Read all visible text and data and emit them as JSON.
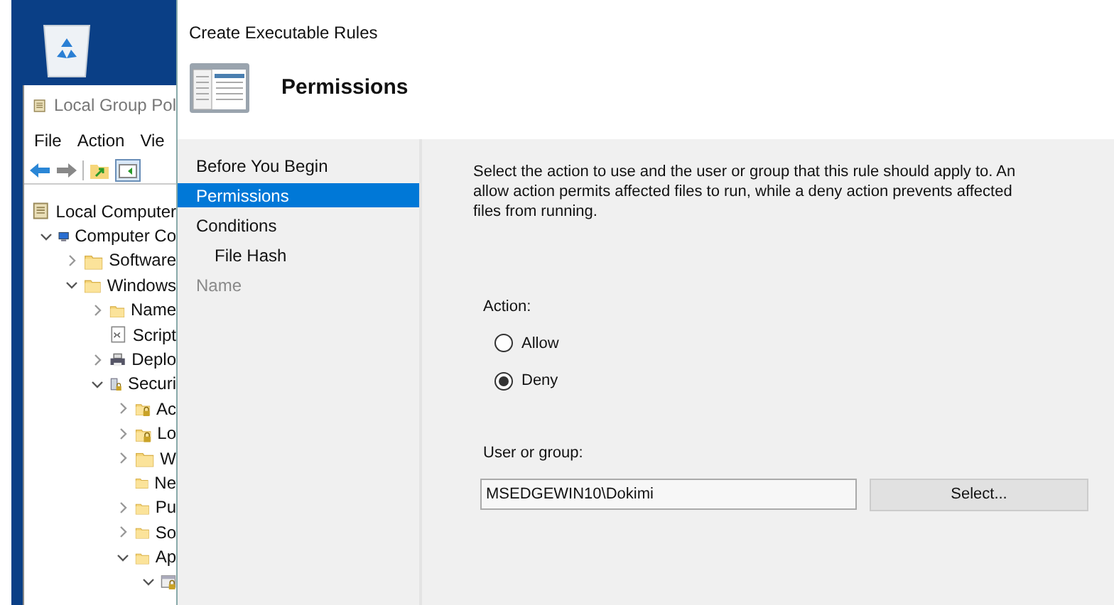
{
  "background_window": {
    "title": "Local Group Pol",
    "menu": [
      "File",
      "Action",
      "Vie"
    ],
    "tree": [
      {
        "label": "Local Computer",
        "kind": "policy",
        "children": [
          {
            "label": "Computer Co",
            "kind": "computer",
            "expanded": true,
            "children": [
              {
                "label": "Software",
                "kind": "folder",
                "expanded": false
              },
              {
                "label": "Windows",
                "kind": "folder",
                "expanded": true,
                "children": [
                  {
                    "label": "Name",
                    "kind": "folder",
                    "expanded": false
                  },
                  {
                    "label": "Script",
                    "kind": "script"
                  },
                  {
                    "label": "Deplo",
                    "kind": "printer",
                    "expanded": false
                  },
                  {
                    "label": "Securi",
                    "kind": "security",
                    "expanded": true,
                    "children": [
                      {
                        "label": "Ac",
                        "kind": "folder-lock",
                        "expanded": false
                      },
                      {
                        "label": "Lo",
                        "kind": "folder-lock",
                        "expanded": false
                      },
                      {
                        "label": "W",
                        "kind": "folder",
                        "expanded": false
                      },
                      {
                        "label": "Ne",
                        "kind": "folder"
                      },
                      {
                        "label": "Pu",
                        "kind": "folder",
                        "expanded": false
                      },
                      {
                        "label": "So",
                        "kind": "folder",
                        "expanded": false
                      },
                      {
                        "label": "Ap",
                        "kind": "folder",
                        "expanded": true,
                        "children": [
                          {
                            "kind": "rules",
                            "expanded": true
                          }
                        ]
                      }
                    ]
                  }
                ]
              }
            ]
          }
        ]
      }
    ]
  },
  "dialog": {
    "title": "Create Executable Rules",
    "heading": "Permissions",
    "steps": [
      {
        "label": "Before You Begin",
        "selected": false,
        "disabled": false,
        "sub": false
      },
      {
        "label": "Permissions",
        "selected": true,
        "disabled": false,
        "sub": false
      },
      {
        "label": "Conditions",
        "selected": false,
        "disabled": false,
        "sub": false
      },
      {
        "label": "File Hash",
        "selected": false,
        "disabled": false,
        "sub": true
      },
      {
        "label": "Name",
        "selected": false,
        "disabled": true,
        "sub": false
      }
    ],
    "description": "Select the action to use and the user or group that this rule should apply to. An allow action permits affected files to run, while a deny action prevents affected files from running.",
    "action_label": "Action:",
    "actions": [
      {
        "label": "Allow",
        "selected": false
      },
      {
        "label": "Deny",
        "selected": true
      }
    ],
    "user_label": "User or group:",
    "user_value": "MSEDGEWIN10\\Dokimi",
    "select_button": "Select..."
  }
}
